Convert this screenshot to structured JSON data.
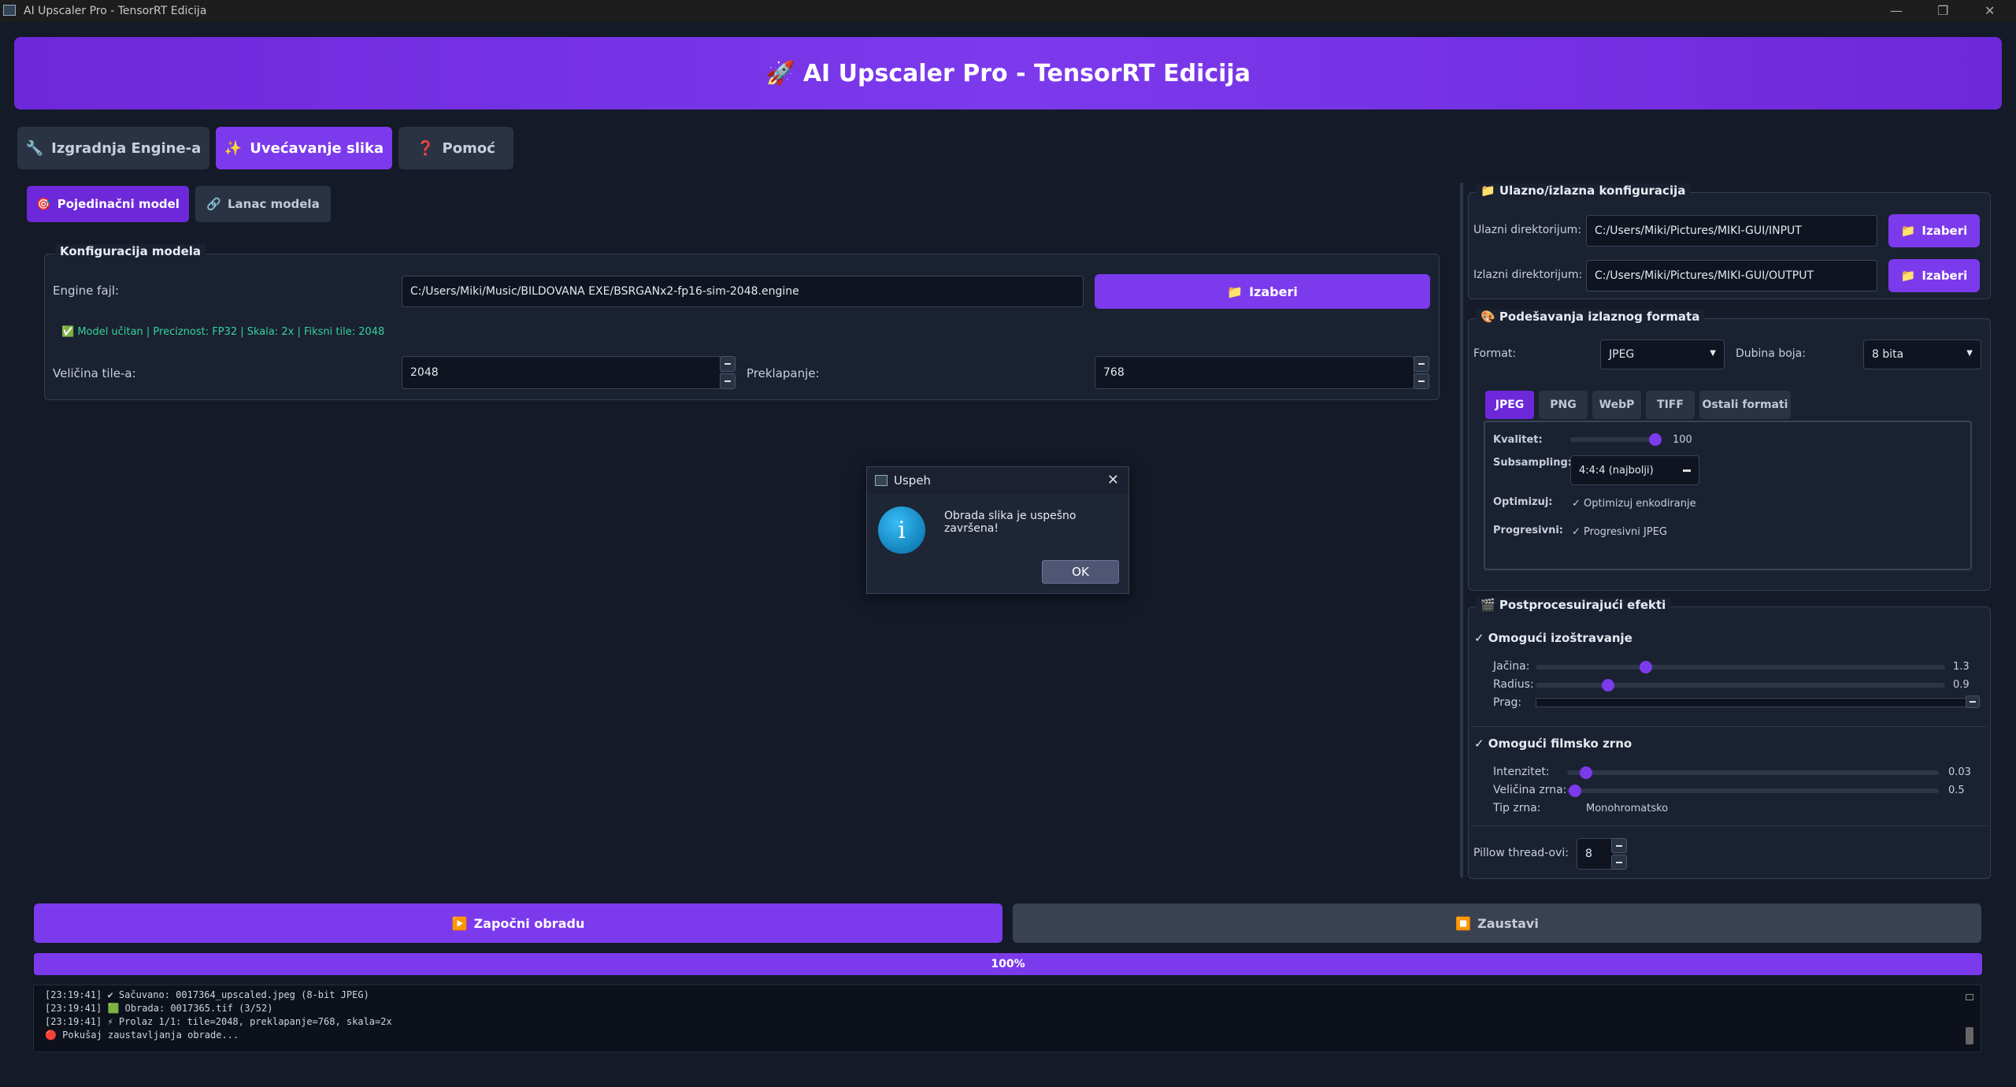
{
  "window": {
    "title": "AI Upscaler Pro - TensorRT Edicija",
    "min": "—",
    "max": "❐",
    "close": "✕"
  },
  "header": {
    "icon": "🚀",
    "title": "AI Upscaler Pro - TensorRT Edicija"
  },
  "tabs": [
    {
      "icon": "🔧",
      "label": "Izgradnja Engine-a"
    },
    {
      "icon": "✨",
      "label": "Uvećavanje slika"
    },
    {
      "icon": "❓",
      "label": "Pomoć"
    }
  ],
  "subtabs": [
    {
      "icon": "🎯",
      "label": "Pojedinačni model"
    },
    {
      "icon": "🔗",
      "label": "Lanac modela"
    }
  ],
  "model_config": {
    "title": "Konfiguracija modela",
    "engine_label": "Engine fajl:",
    "engine_value": "C:/Users/Miki/Music/BILDOVANA EXE/BSRGANx2-fp16-sim-2048.engine",
    "choose_icon": "📁",
    "choose_label": "Izaberi",
    "status": "✅ Model učitan | Preciznost: FP32 | Skala: 2x | Fiksni tile: 2048",
    "tile_label": "Veličina tile-a:",
    "tile_value": "2048",
    "overlap_label": "Preklapanje:",
    "overlap_value": "768"
  },
  "io": {
    "icon": "📁",
    "title": "Ulazno/izlazna konfiguracija",
    "input_label": "Ulazni direktorijum:",
    "input_value": "C:/Users/Miki/Pictures/MIKI-GUI/INPUT",
    "output_label": "Izlazni direktorijum:",
    "output_value": "C:/Users/Miki/Pictures/MIKI-GUI/OUTPUT",
    "choose_label": "Izaberi"
  },
  "output_format": {
    "icon": "🎨",
    "title": "Podešavanja izlaznog formata",
    "format_label": "Format:",
    "format_value": "JPEG",
    "depth_label": "Dubina boja:",
    "depth_value": "8 bita",
    "format_tabs": [
      "JPEG",
      "PNG",
      "WebP",
      "TIFF",
      "Ostali formati"
    ],
    "quality_label": "Kvalitet:",
    "quality_value": "100",
    "subsampling_label": "Subsampling:",
    "subsampling_value": "4:4:4 (najbolji)",
    "optimize_label": "Optimizuj:",
    "optimize_check": "Optimizuj enkodiranje",
    "progressive_label": "Progresivni:",
    "progressive_check": "Progresivni JPEG"
  },
  "post": {
    "icon": "🎬",
    "title": "Postprocesuirajući efekti",
    "sharpen_label": "Omogući izoštravanje",
    "strength_label": "Jačina:",
    "strength_value": "1.3",
    "radius_label": "Radius:",
    "radius_value": "0.9",
    "threshold_label": "Prag:",
    "grain_label": "Omogući filmsko zrno",
    "intensity_label": "Intenzitet:",
    "intensity_value": "0.03",
    "grain_size_label": "Veličina zrna:",
    "grain_size_value": "0.5",
    "grain_type_label": "Tip zrna:",
    "grain_type_value": "Monohromatsko",
    "threads_label": "Pillow thread-ovi:",
    "threads_value": "8"
  },
  "actions": {
    "start_icon": "▶️",
    "start_label": "Započni obradu",
    "stop_icon": "⏹️",
    "stop_label": "Zaustavi"
  },
  "progress": {
    "value": 1.0,
    "label": "100%"
  },
  "log": [
    "[23:19:41] ✔ Sačuvano: 0017364_upscaled.jpeg (8-bit JPEG)",
    "[23:19:41] 🟩 Obrada: 0017365.tif (3/52)",
    "[23:19:41]   ⚡ Prolaz 1/1: tile=2048, preklapanje=768, skala=2x",
    "🔴 Pokušaj zaustavljanja obrade..."
  ],
  "dialog": {
    "title": "Uspeh",
    "message": "Obrada slika je uspešno završena!",
    "ok": "OK",
    "icon": "i"
  },
  "colors": {
    "accent": "#7c3aed",
    "background": "#141a28",
    "success": "#34d399"
  }
}
